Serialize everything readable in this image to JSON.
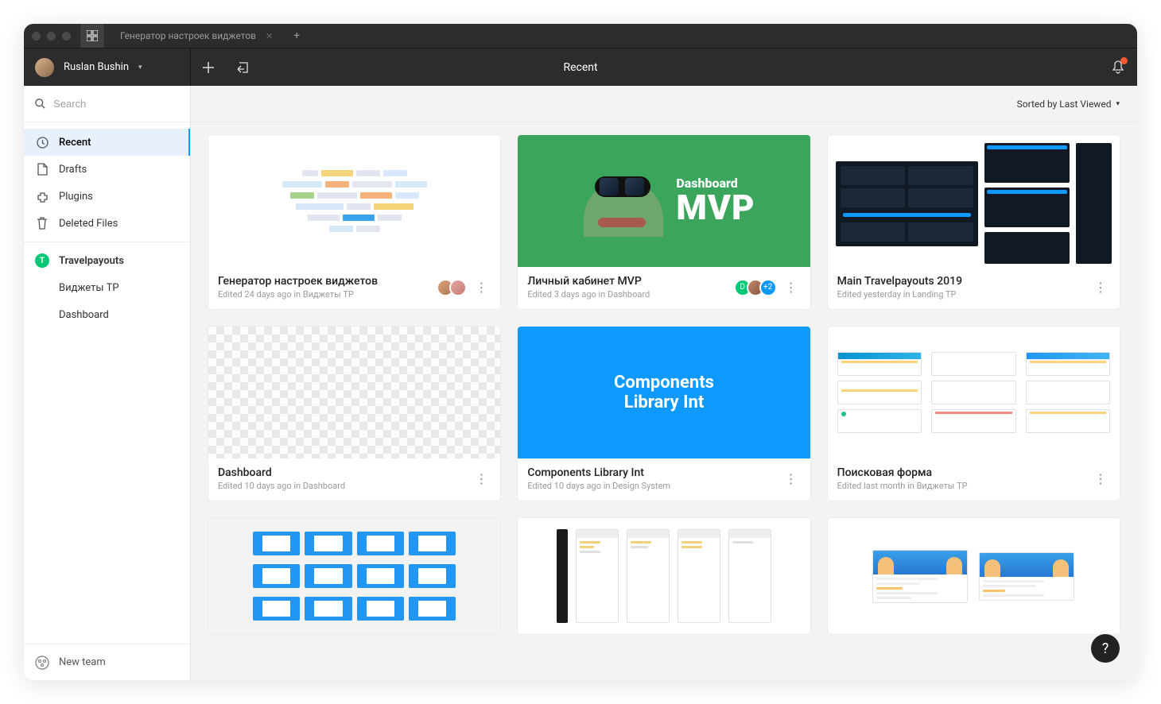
{
  "titlebar": {
    "tab_title": "Генератор настроек виджетов"
  },
  "header": {
    "user_name": "Ruslan Bushin",
    "center_title": "Recent"
  },
  "search": {
    "placeholder": "Search"
  },
  "nav": {
    "recent": "Recent",
    "drafts": "Drafts",
    "plugins": "Plugins",
    "deleted": "Deleted Files"
  },
  "team": {
    "initial": "T",
    "name": "Travelpayouts",
    "projects": [
      "Виджеты TP",
      "Dashboard"
    ]
  },
  "footer": {
    "new_team": "New team"
  },
  "sort": {
    "label": "Sorted by Last Viewed"
  },
  "files": [
    {
      "title": "Генератор настроек виджетов",
      "sub": "Edited 24 days ago in Виджеты TP",
      "thumb_text_1": "",
      "thumb_text_2": "",
      "plus_badge": ""
    },
    {
      "title": "Личный кабинет MVP",
      "sub": "Edited 3 days ago in Dashboard",
      "thumb_text_1": "Dashboard",
      "thumb_text_2": "MVP",
      "plus_badge": "+2",
      "avD": "D"
    },
    {
      "title": "Main Travelpayouts 2019",
      "sub": "Edited yesterday in Landing TP",
      "thumb_text_1": "",
      "thumb_text_2": "",
      "plus_badge": ""
    },
    {
      "title": "Dashboard",
      "sub": "Edited 10 days ago in Dashboard",
      "thumb_text_1": "",
      "thumb_text_2": "",
      "plus_badge": ""
    },
    {
      "title": "Components Library Int",
      "sub": "Edited 10 days ago in Design System",
      "thumb_text_1": "Components",
      "thumb_text_2": "Library Int",
      "plus_badge": ""
    },
    {
      "title": "Поисковая форма",
      "sub": "Edited last month in Виджеты TP",
      "thumb_text_1": "",
      "thumb_text_2": "",
      "plus_badge": ""
    }
  ],
  "help": "?"
}
